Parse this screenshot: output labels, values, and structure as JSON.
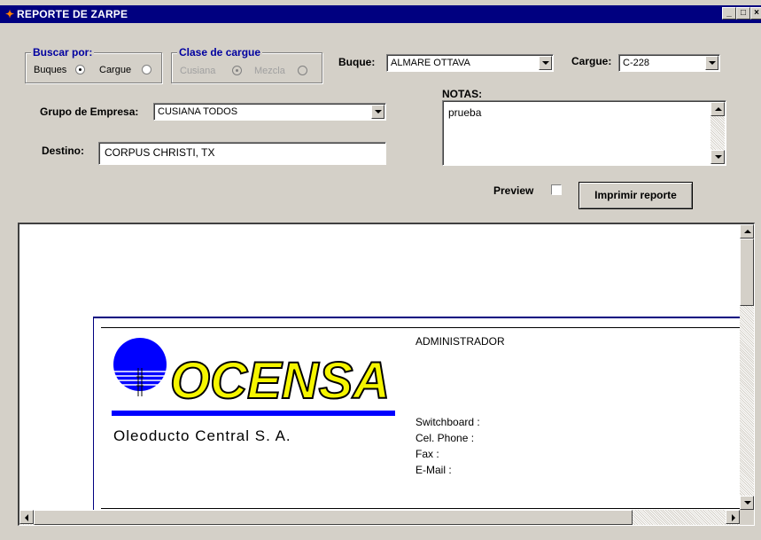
{
  "window": {
    "title": "REPORTE DE ZARPE",
    "controls": {
      "minimize": "_",
      "maximize": "□",
      "close": "×"
    }
  },
  "search_by": {
    "legend": "Buscar por:",
    "options": [
      {
        "label": "Buques",
        "selected": true
      },
      {
        "label": "Cargue",
        "selected": false
      }
    ]
  },
  "load_class": {
    "legend": "Clase de cargue",
    "options": [
      {
        "label": "Cusiana",
        "selected": true,
        "enabled": false
      },
      {
        "label": "Mezcla",
        "selected": false,
        "enabled": false
      }
    ]
  },
  "vessel": {
    "label": "Buque:",
    "value": "ALMARE OTTAVA"
  },
  "load": {
    "label": "Cargue:",
    "value": "C-228"
  },
  "company_group": {
    "label": "Grupo de Empresa:",
    "value": "CUSIANA TODOS"
  },
  "destination": {
    "label": "Destino:",
    "value": "CORPUS CHRISTI, TX"
  },
  "notes": {
    "label": "NOTAS:",
    "value": "prueba"
  },
  "preview": {
    "label": "Preview",
    "checked": false
  },
  "print_button": {
    "label": "Imprimir reporte"
  },
  "report": {
    "logo": {
      "brand": "OCENSA",
      "tagline": "Oleoducto  Central  S. A."
    },
    "header_title": "ADMINISTRADOR",
    "contact_fields": [
      "Switchboard :",
      "Cel. Phone :",
      "Fax :",
      "E-Mail :"
    ]
  },
  "colors": {
    "titlebar": "#000080",
    "legend": "#0000a0",
    "logo_yellow": "#f5f500",
    "logo_blue": "#0000ff"
  }
}
